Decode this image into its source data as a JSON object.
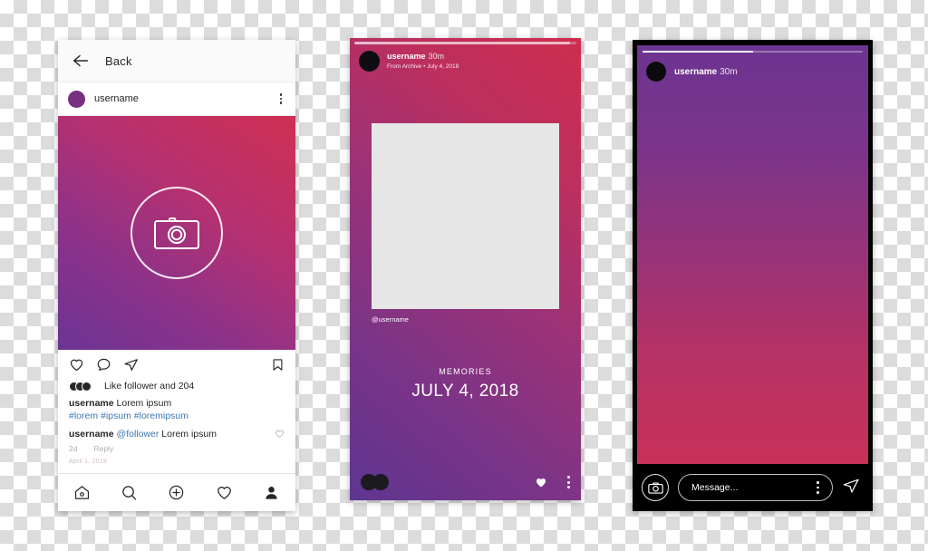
{
  "background": {
    "checker_light": "#ffffff",
    "checker_dark": "#dcdcdc"
  },
  "phone1": {
    "back_label": "Back",
    "username": "username",
    "media_placeholder_icon": "camera-icon",
    "actions": [
      "heart-icon",
      "comment-icon",
      "share-icon",
      "bookmark-icon"
    ],
    "likes_text": "Like follower and 204",
    "caption_user": "username",
    "caption_text": "Lorem ipsum",
    "hashtags": "#lorem #ipsum #loremipsum",
    "comment_user": "username",
    "comment_mention": "@follower",
    "comment_text": "Lorem ipsum",
    "comment_time": "2d",
    "comment_reply": "Reply",
    "post_date": "April 1, 2019",
    "nav": [
      "home-icon",
      "search-icon",
      "add-icon",
      "activity-icon",
      "profile-icon"
    ],
    "colors": {
      "avatar": "#78317f",
      "link": "#3e78b0",
      "text": "#262626"
    }
  },
  "phone2": {
    "username": "username",
    "time_ago": "30m",
    "subtitle": "From Archive • July 4, 2018",
    "card_username": "@username",
    "memories_label": "MEMORIES",
    "memories_date": "JULY 4, 2018",
    "footer_icons": [
      "viewers-icon",
      "heart-filled-icon",
      "more-icon"
    ],
    "progress_percent": 97,
    "colors": {
      "card": "#e6e6e6",
      "gradient_start": "#5e3591",
      "gradient_end": "#cd2d4e"
    }
  },
  "phone3": {
    "username": "username",
    "time_ago": "30m",
    "message_placeholder": "Message...",
    "footer_icons": [
      "camera-icon",
      "more-icon",
      "send-icon"
    ],
    "progress_percent": 50,
    "colors": {
      "gradient_start": "#6c3491",
      "gradient_end": "#c83158",
      "chrome": "#000000"
    }
  }
}
